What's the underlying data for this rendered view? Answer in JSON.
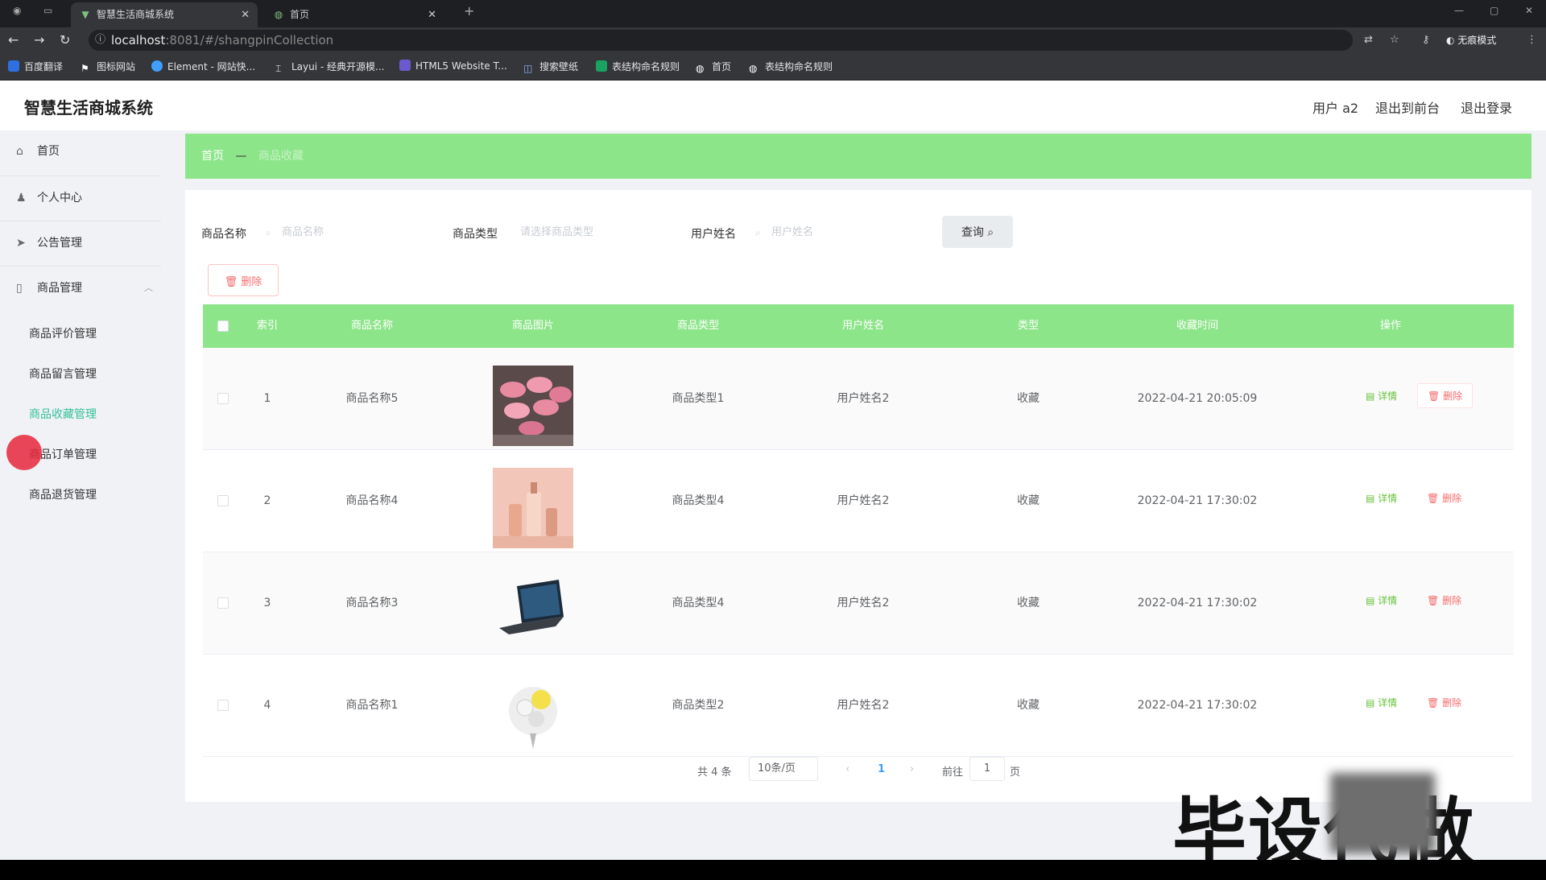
{
  "browser": {
    "tabs": [
      {
        "label": "智慧生活商城系统",
        "active": true
      },
      {
        "label": "首页",
        "active": false
      }
    ],
    "url_host": "localhost",
    "url_rest": ":8081/#/shangpinCollection",
    "incognito_label": "无痕模式",
    "bookmarks": [
      "百度翻译",
      "图标网站",
      "Element - 网站快...",
      "Layui - 经典开源模...",
      "HTML5 Website T...",
      "搜索壁纸",
      "表结构命名规则",
      "首页",
      "表结构命名规则"
    ]
  },
  "header": {
    "title": "智慧生活商城系统",
    "user_label": "用户 a2",
    "back_label": "退出到前台",
    "logout_label": "退出登录"
  },
  "sidebar": {
    "items": [
      {
        "label": "首页",
        "icon": "home-icon"
      },
      {
        "label": "个人中心",
        "icon": "user-icon"
      },
      {
        "label": "公告管理",
        "icon": "send-icon"
      },
      {
        "label": "商品管理",
        "icon": "phone-icon"
      }
    ],
    "sub_items": [
      "商品评价管理",
      "商品留言管理",
      "商品收藏管理",
      "商品订单管理",
      "商品退货管理"
    ],
    "active_sub": "商品收藏管理"
  },
  "breadcrumb": {
    "home": "首页",
    "sep": "—",
    "current": "商品收藏"
  },
  "filters": {
    "name_label": "商品名称",
    "name_placeholder": "商品名称",
    "type_label": "商品类型",
    "type_placeholder": "请选择商品类型",
    "user_label": "用户姓名",
    "user_placeholder": "用户姓名",
    "query_label": "查询"
  },
  "delete_label": "删除",
  "table": {
    "headers": [
      "索引",
      "商品名称",
      "商品图片",
      "商品类型",
      "用户姓名",
      "类型",
      "收藏时间",
      "操作"
    ],
    "rows": [
      {
        "index": "1",
        "name": "商品名称5",
        "type": "商品类型1",
        "user": "用户姓名2",
        "kind": "收藏",
        "time": "2022-04-21 20:05:09",
        "image": "pink-macarons"
      },
      {
        "index": "2",
        "name": "商品名称4",
        "type": "商品类型4",
        "user": "用户姓名2",
        "kind": "收藏",
        "time": "2022-04-21 17:30:02",
        "image": "pink-bottles"
      },
      {
        "index": "3",
        "name": "商品名称3",
        "type": "商品类型4",
        "user": "用户姓名2",
        "kind": "收藏",
        "time": "2022-04-21 17:30:02",
        "image": "laptop"
      },
      {
        "index": "4",
        "name": "商品名称1",
        "type": "商品类型2",
        "user": "用户姓名2",
        "kind": "收藏",
        "time": "2022-04-21 17:30:02",
        "image": "flower-bouquet"
      }
    ],
    "view_label": "详情",
    "delete_label": "删除"
  },
  "pagination": {
    "total": "共 4 条",
    "page_size": "10条/页",
    "current": "1",
    "goto_label": "前往",
    "goto_value": "1",
    "page_suffix": "页"
  },
  "watermark": "毕设代做",
  "colors": {
    "accent": "#8de58a",
    "active_menu": "#35c19b",
    "danger": "#f56c6c",
    "success": "#67c23a"
  }
}
